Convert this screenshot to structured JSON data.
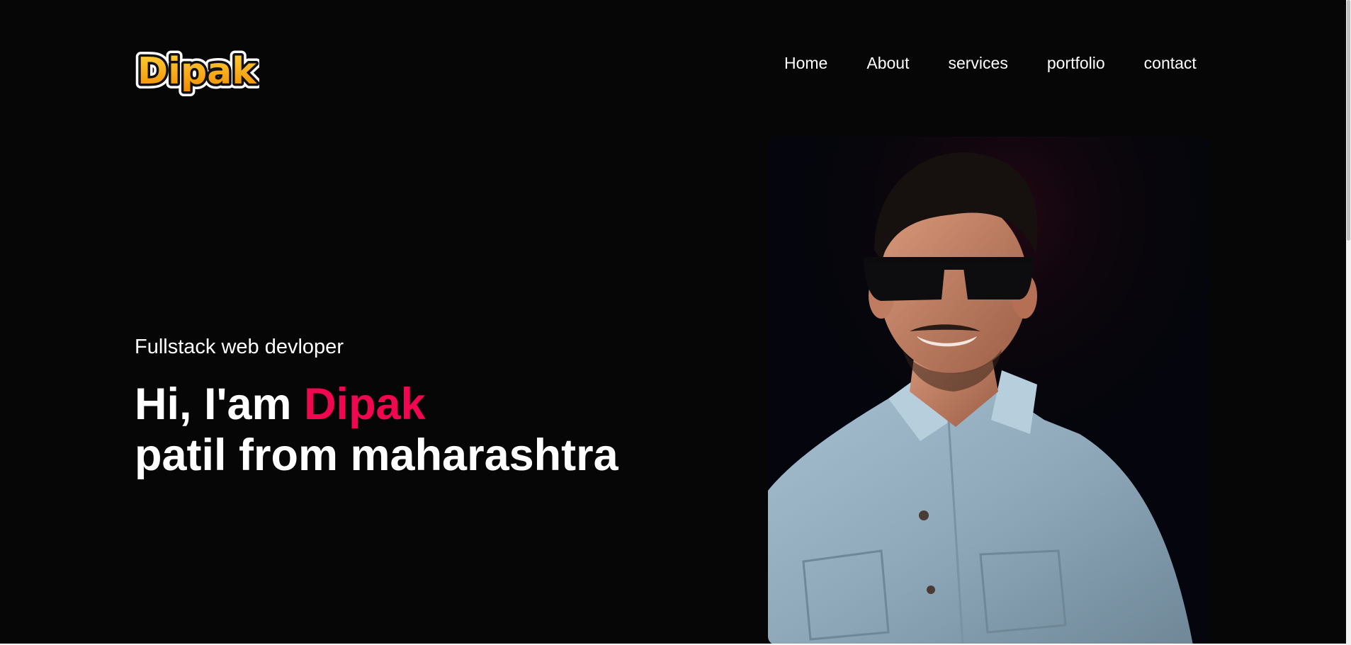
{
  "header": {
    "logo_text": "Dipak",
    "logo_icon": "dipak-wordmark-logo"
  },
  "nav": {
    "items": [
      {
        "label": "Home"
      },
      {
        "label": "About"
      },
      {
        "label": "services"
      },
      {
        "label": "portfolio"
      },
      {
        "label": "contact"
      }
    ]
  },
  "hero": {
    "subtitle": "Fullstack web devloper",
    "greeting": "Hi, I'am ",
    "name": "Dipak",
    "line2": "patil from maharashtra",
    "accent_color": "#f1074f",
    "portrait_icon": "profile-photo"
  },
  "colors": {
    "background": "#060607",
    "text": "#ffffff",
    "accent": "#f1074f"
  }
}
